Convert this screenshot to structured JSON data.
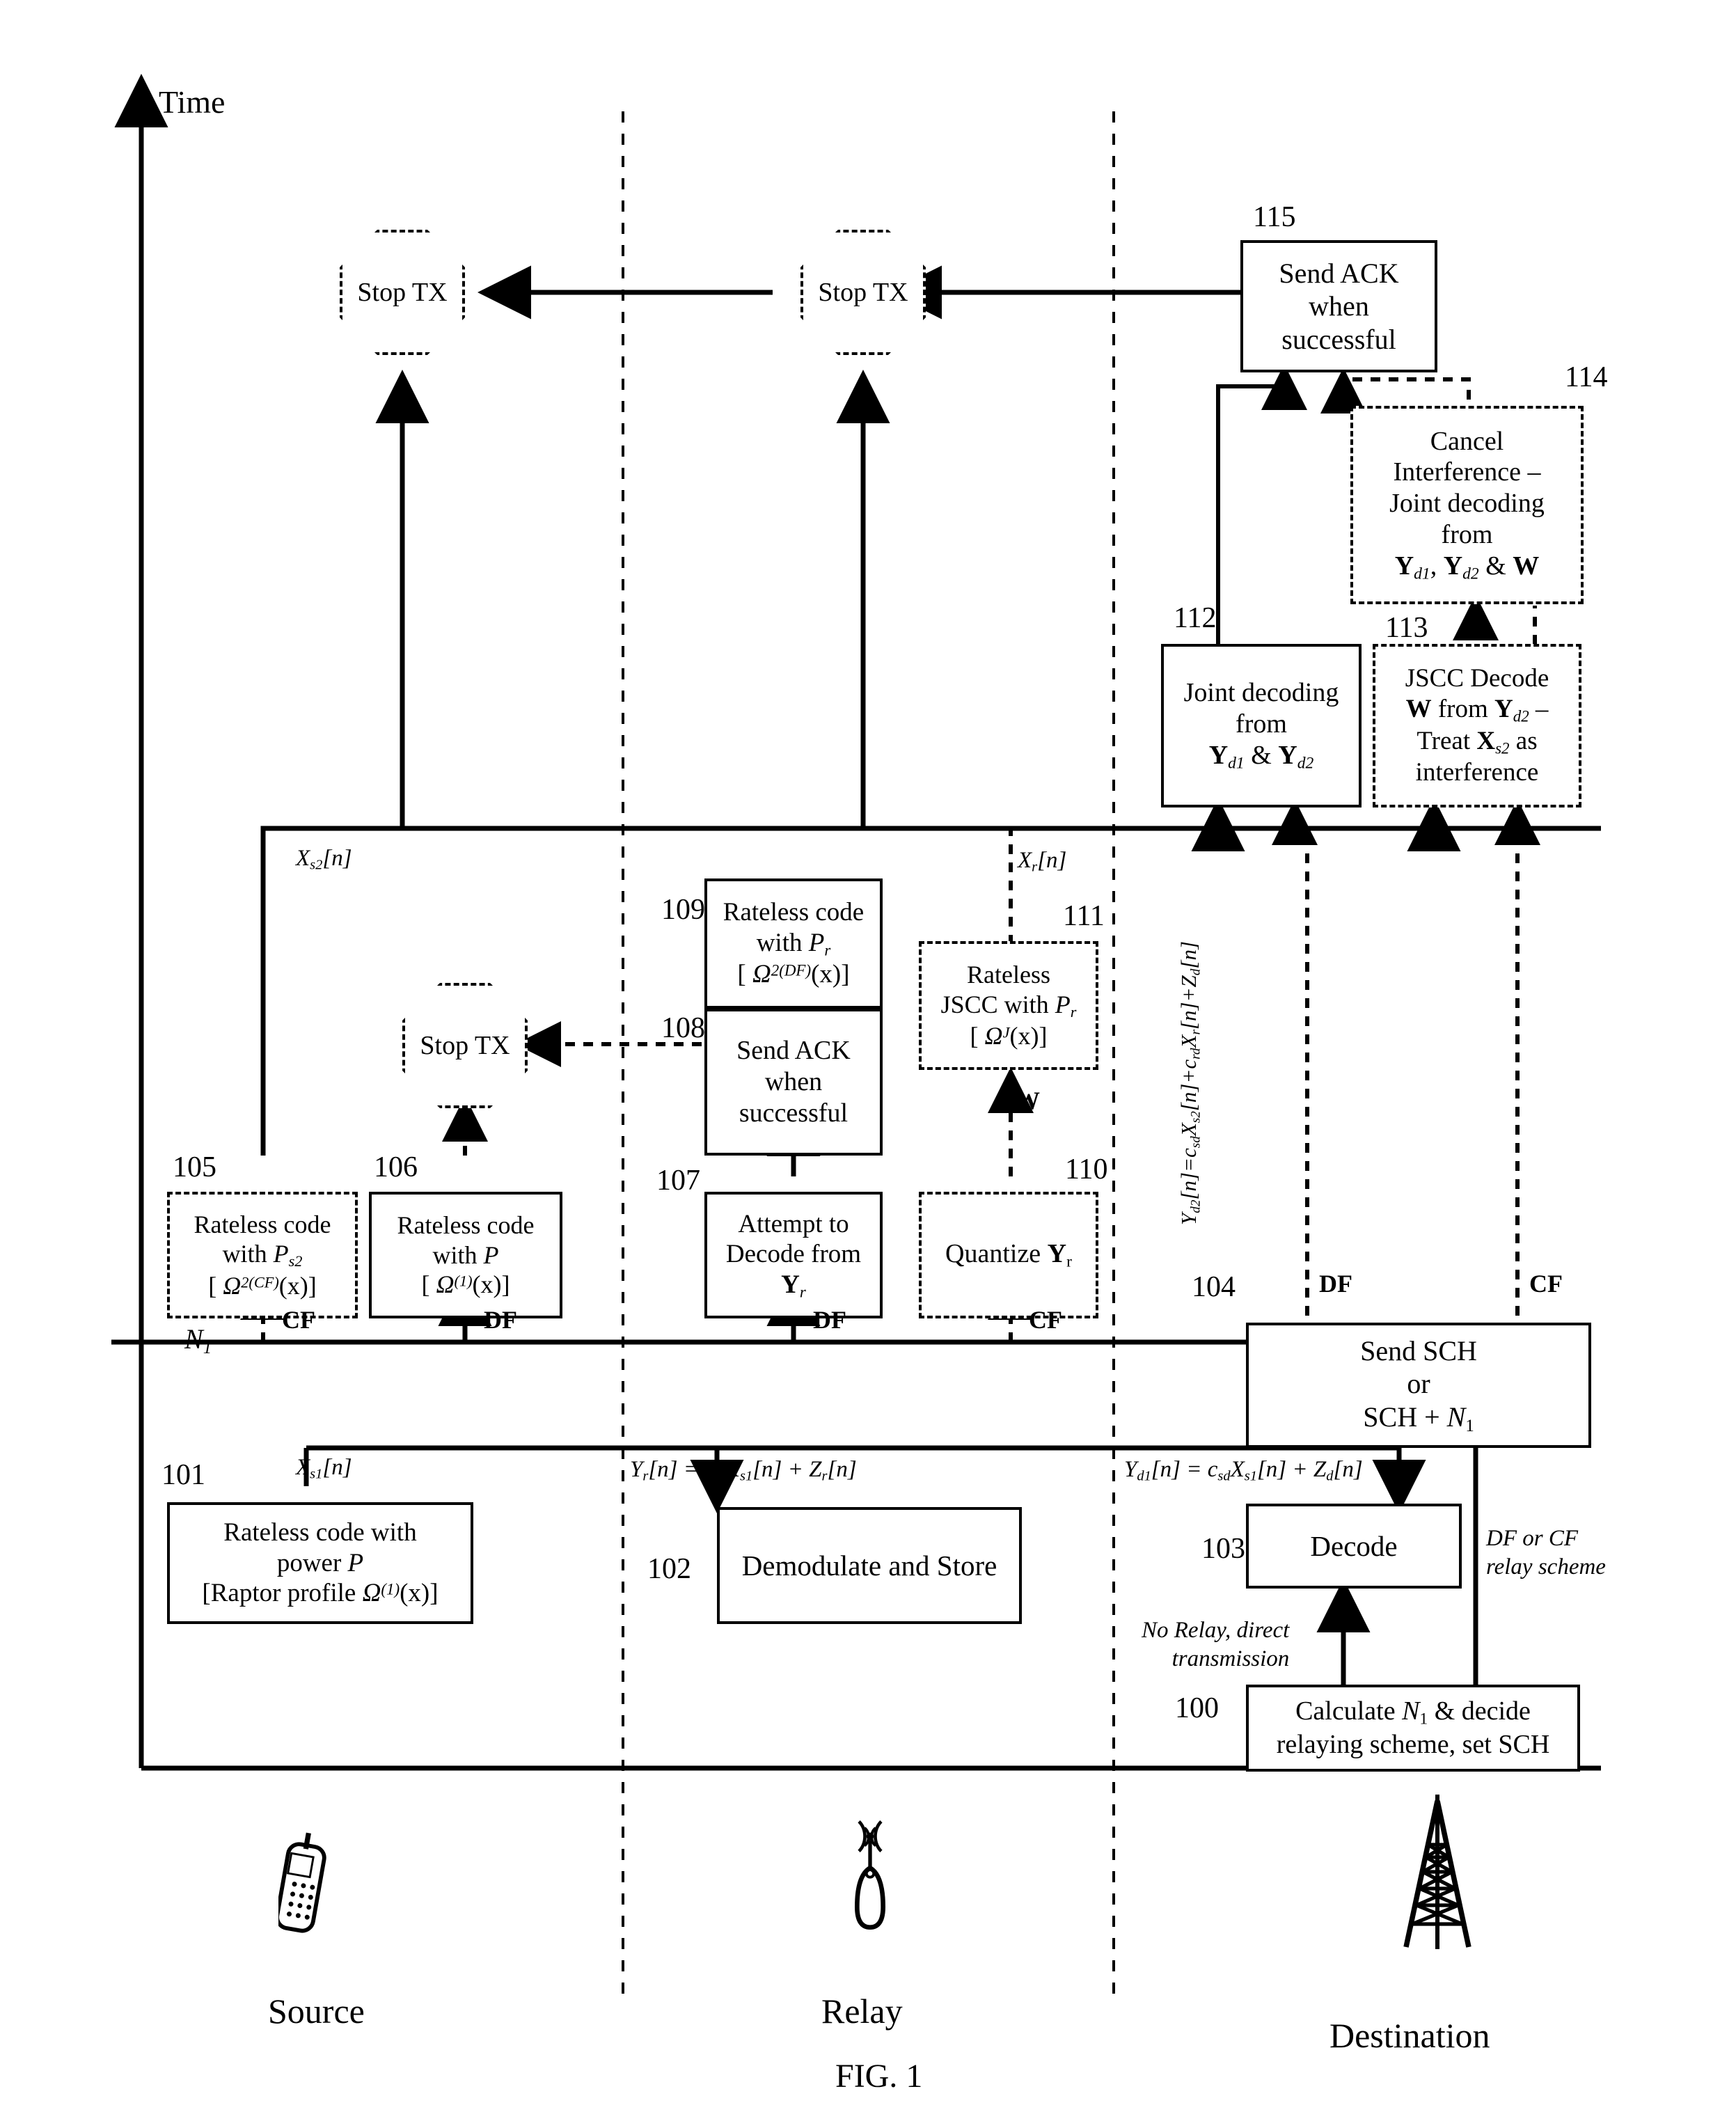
{
  "figure": {
    "caption": "FIG. 1",
    "time_axis_label": "Time",
    "n1_label": "N1"
  },
  "lanes": [
    {
      "name": "source",
      "label": "Source",
      "icon": "mobile-phone-icon"
    },
    {
      "name": "relay",
      "label": "Relay",
      "icon": "antenna-icon"
    },
    {
      "name": "destination",
      "label": "Destination",
      "icon": "cell-tower-icon"
    }
  ],
  "nodes": {
    "n100": {
      "number": "100",
      "lines": [
        "Calculate N1 & decide",
        "relaying scheme, set SCH"
      ],
      "style": "solid"
    },
    "n101": {
      "number": "101",
      "lines": [
        "Rateless code with",
        "power P",
        "[Raptor profile Ω(1)(x)]"
      ],
      "style": "solid"
    },
    "n102": {
      "number": "102",
      "lines": [
        "Demodulate and Store"
      ],
      "style": "solid"
    },
    "n103": {
      "number": "103",
      "lines": [
        "Decode"
      ],
      "style": "solid"
    },
    "n104": {
      "number": "104",
      "lines": [
        "Send SCH",
        "or",
        "SCH + N1"
      ],
      "style": "solid"
    },
    "n105": {
      "number": "105",
      "lines": [
        "Rateless code",
        "with Ps2",
        "[ Ω2(CF)(x)]"
      ],
      "style": "dashed"
    },
    "n106": {
      "number": "106",
      "lines": [
        "Rateless code",
        "with P",
        "[ Ω(1)(x)]"
      ],
      "style": "solid"
    },
    "n107": {
      "number": "107",
      "lines": [
        "Attempt to",
        "Decode from",
        "Yr"
      ],
      "style": "solid"
    },
    "n108": {
      "number": "108",
      "lines": [
        "Send ACK",
        "when",
        "successful"
      ],
      "style": "solid"
    },
    "n109": {
      "number": "109",
      "lines": [
        "Rateless code",
        "with Pr",
        "[ Ω2(DF)(x)]"
      ],
      "style": "solid"
    },
    "n110": {
      "number": "110",
      "lines": [
        "Quantize Yr"
      ],
      "style": "dashed"
    },
    "n111": {
      "number": "111",
      "lines": [
        "Rateless",
        "JSCC with Pr",
        "[ ΩJ(x)]"
      ],
      "style": "dashed"
    },
    "n112": {
      "number": "112",
      "lines": [
        "Joint decoding",
        "from",
        "Yd1 & Yd2"
      ],
      "style": "solid"
    },
    "n113": {
      "number": "113",
      "lines": [
        "JSCC Decode",
        "W from Yd2 –",
        "Treat Xs2 as",
        "interference"
      ],
      "style": "dashed"
    },
    "n114": {
      "number": "114",
      "lines": [
        "Cancel",
        "Interference –",
        "Joint  decoding",
        "from",
        "Yd1, Yd2 & W"
      ],
      "style": "dashed"
    },
    "n115": {
      "number": "115",
      "lines": [
        "Send ACK",
        "when",
        "successful"
      ],
      "style": "solid"
    }
  },
  "terminators": [
    {
      "name": "stop-tx-source",
      "label": "Stop TX"
    },
    {
      "name": "stop-tx-relay",
      "label": "Stop TX"
    },
    {
      "name": "stop-tx-source-mid",
      "label": "Stop TX"
    }
  ],
  "signal_labels": {
    "x_s1": "Xs1[n]",
    "x_s2": "Xs2[n]",
    "x_r": "Xr[n]",
    "w": "W",
    "y_r_eq": "Yr[n] = csr Xs1[n] + Zr[n]",
    "y_d1_eq": "Yd1[n] = csd Xs1[n] + Zd[n]",
    "y_d2_eq": "Yd2[n]=csd Xs2[n]+crd Xr[n]+Zd[n]"
  },
  "branch_tags": {
    "df": "DF",
    "cf": "CF",
    "df_or_cf": "DF or CF\nrelay scheme",
    "no_relay": "No Relay, direct\ntransmission"
  }
}
